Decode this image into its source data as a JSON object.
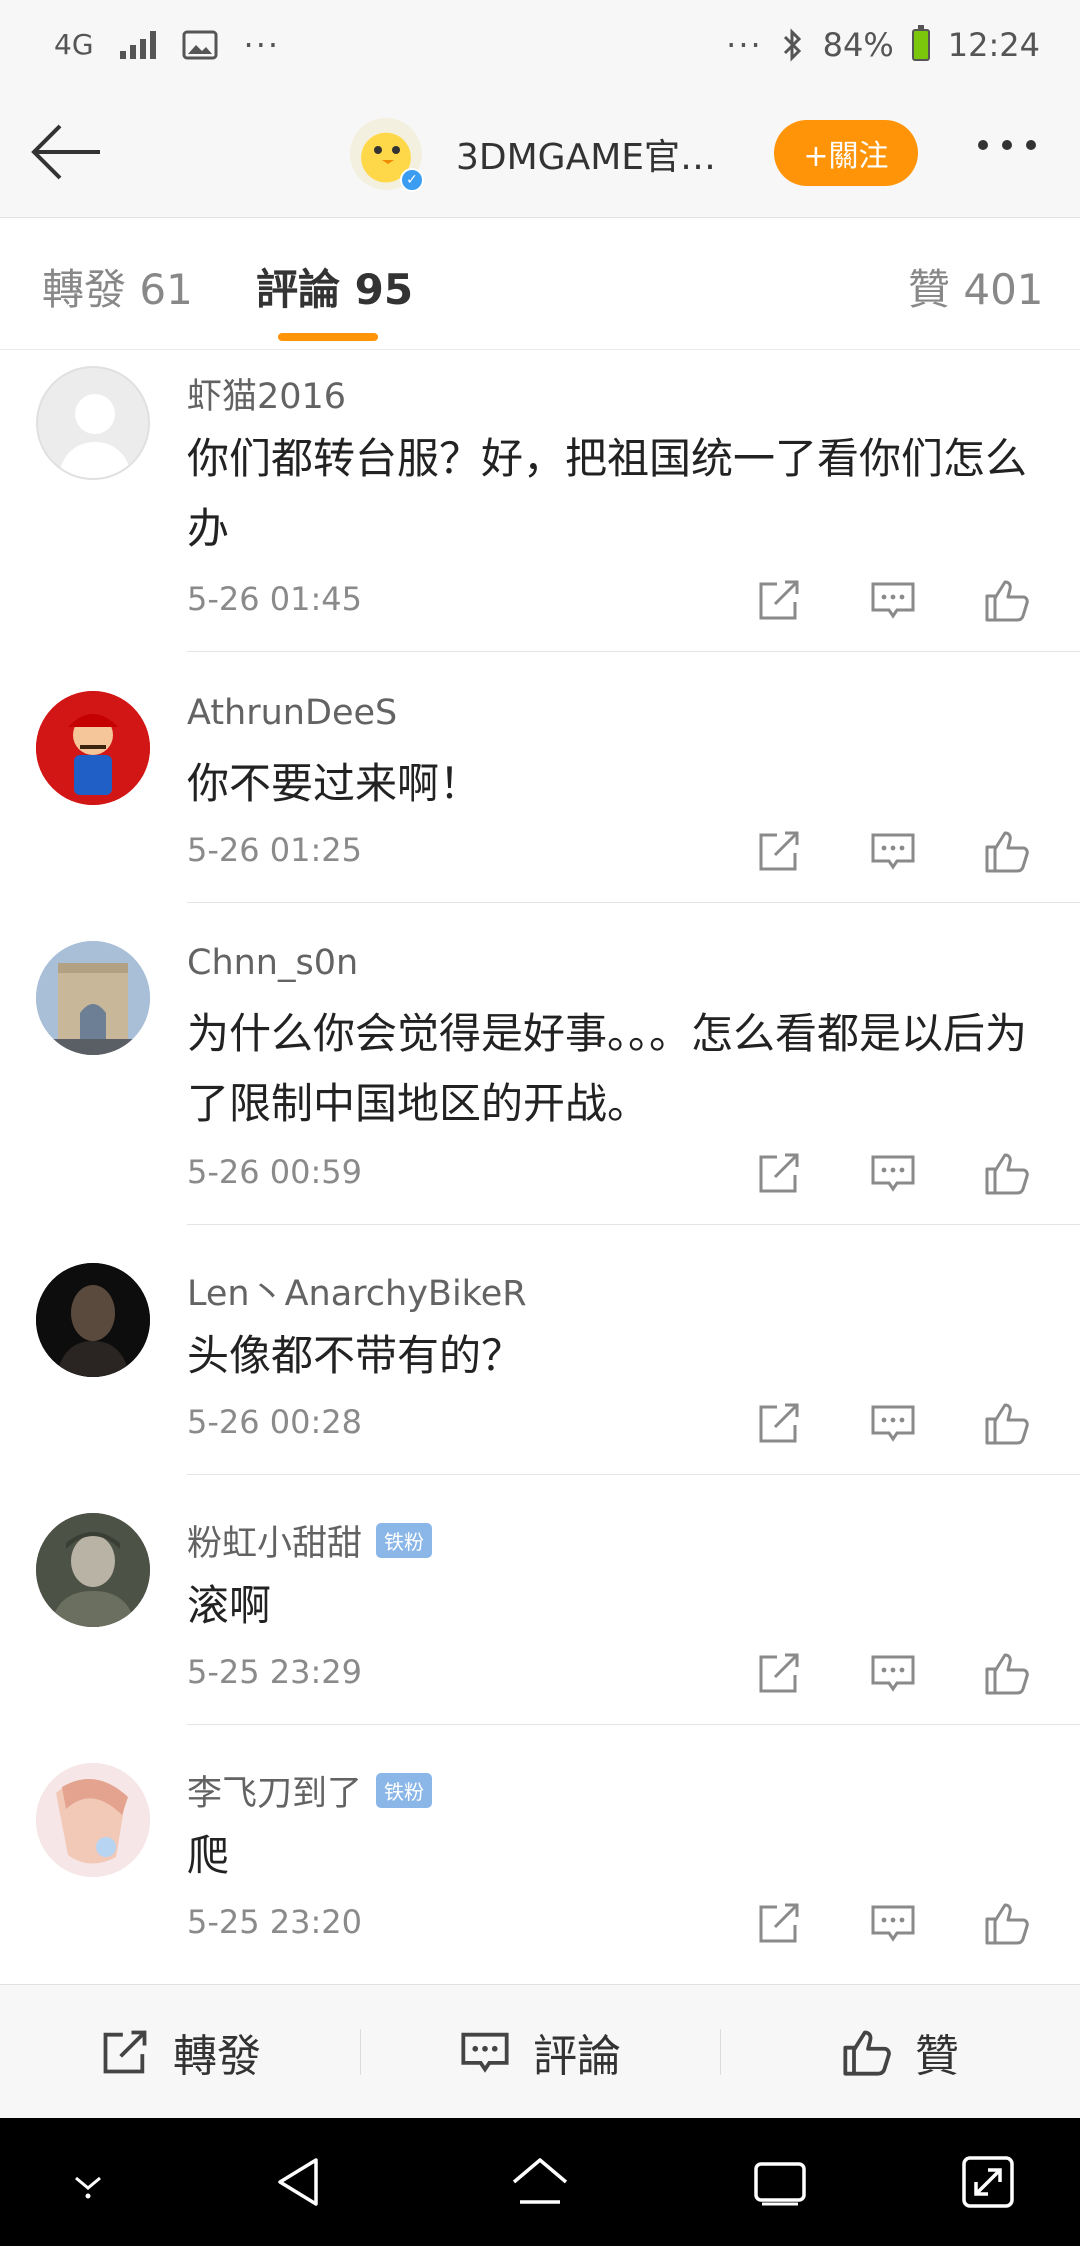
{
  "status_bar": {
    "network": "4G",
    "dots": "···",
    "more_dots": "···",
    "battery": "84%",
    "time": "12:24"
  },
  "header": {
    "account_name": "3DMGAME官…",
    "follow_label": "+關注"
  },
  "tabs": {
    "repost": "轉發 61",
    "comments": "評論 95",
    "likes": "贊 401"
  },
  "comments": [
    {
      "user": "虾猫2016",
      "badge": "",
      "text": "你们都转台服？好，把祖国统一了看你们怎么办",
      "time": "5-26 01:45"
    },
    {
      "user": "AthrunDeeS",
      "badge": "",
      "text": "你不要过来啊！",
      "time": "5-26 01:25"
    },
    {
      "user": "Chnn_s0n",
      "badge": "",
      "text": "为什么你会觉得是好事。。。怎么看都是以后为了限制中国地区的开战。",
      "time": "5-26 00:59"
    },
    {
      "user": "Len丶AnarchyBikeR",
      "badge": "",
      "text": "头像都不带有的？",
      "time": "5-26 00:28"
    },
    {
      "user": "粉虹小甜甜",
      "badge": "铁粉",
      "text": "滚啊",
      "time": "5-25 23:29"
    },
    {
      "user": "李飞刀到了",
      "badge": "铁粉",
      "text": "爬",
      "time": "5-25 23:20"
    }
  ],
  "action_bar": {
    "repost": "轉發",
    "comment": "評論",
    "like": "贊"
  },
  "colors": {
    "accent": "#ff9408",
    "badge": "#8ab6e8"
  }
}
